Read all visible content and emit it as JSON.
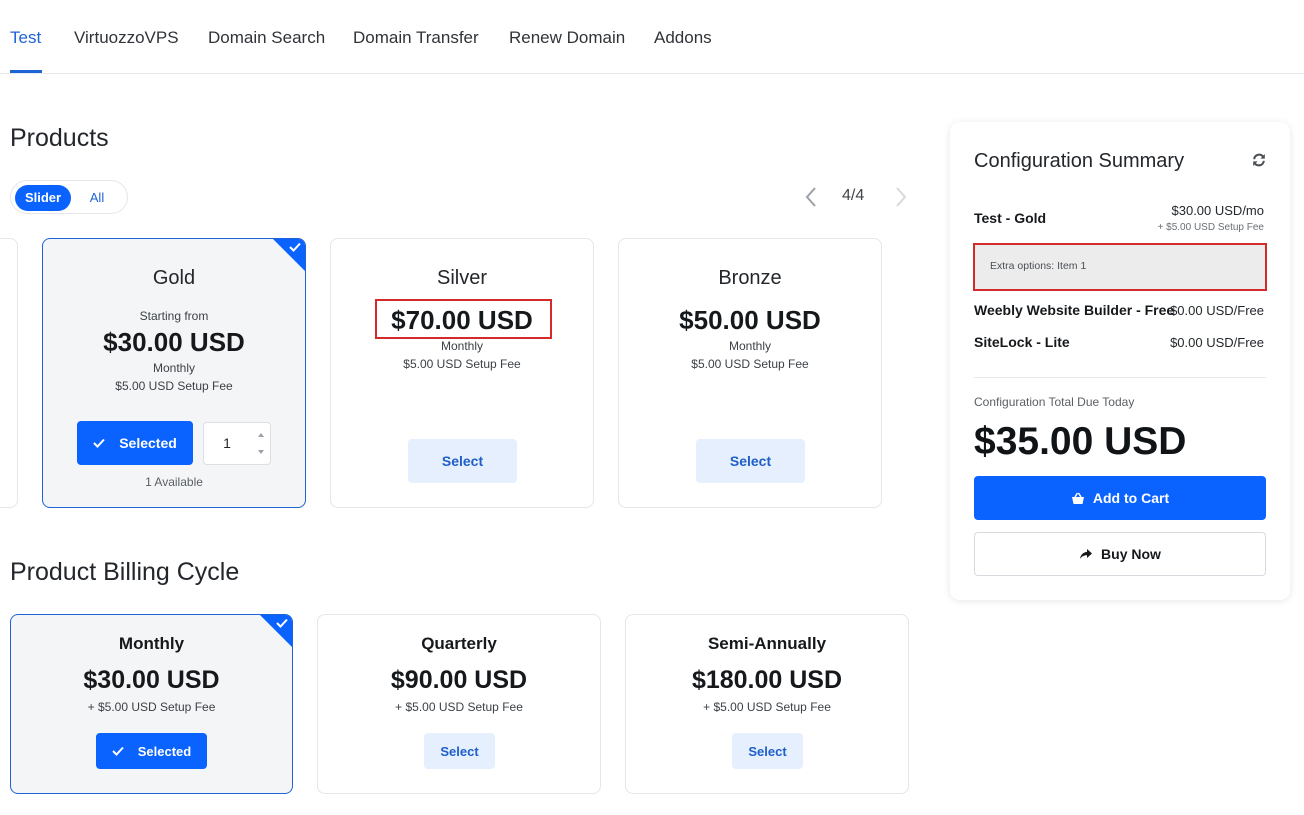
{
  "nav": {
    "tabs": [
      {
        "label": "Test",
        "active": true
      },
      {
        "label": "VirtuozzoVPS",
        "active": false
      },
      {
        "label": "Domain Search",
        "active": false
      },
      {
        "label": "Domain Transfer",
        "active": false
      },
      {
        "label": "Renew Domain",
        "active": false
      },
      {
        "label": "Addons",
        "active": false
      }
    ]
  },
  "products": {
    "title": "Products",
    "view_toggle": {
      "slider": "Slider",
      "all": "All",
      "selected": "Slider"
    },
    "pager": {
      "count": "4/4"
    },
    "cards": [
      {
        "name": "Gold",
        "starting_label": "Starting from",
        "price": "$30.00 USD",
        "cycle": "Monthly",
        "setup": "$5.00 USD Setup Fee",
        "button": "Selected",
        "quantity": "1",
        "available": "1 Available",
        "selected": true
      },
      {
        "name": "Silver",
        "price": "$70.00 USD",
        "cycle": "Monthly",
        "setup": "$5.00 USD Setup Fee",
        "button": "Select",
        "selected": false
      },
      {
        "name": "Bronze",
        "price": "$50.00 USD",
        "cycle": "Monthly",
        "setup": "$5.00 USD Setup Fee",
        "button": "Select",
        "selected": false
      }
    ]
  },
  "billing": {
    "title": "Product Billing Cycle",
    "cycles": [
      {
        "name": "Monthly",
        "price": "$30.00 USD",
        "setup": "+ $5.00 USD Setup Fee",
        "button": "Selected",
        "selected": true
      },
      {
        "name": "Quarterly",
        "price": "$90.00 USD",
        "setup": "+ $5.00 USD Setup Fee",
        "button": "Select",
        "selected": false
      },
      {
        "name": "Semi-Annually",
        "price": "$180.00 USD",
        "setup": "+ $5.00 USD Setup Fee",
        "button": "Select",
        "selected": false
      }
    ]
  },
  "summary": {
    "title": "Configuration Summary",
    "product_name": "Test - Gold",
    "product_price": "$30.00 USD/mo",
    "product_setup": "+ $5.00 USD Setup Fee",
    "extra_options": "Extra options: Item 1",
    "lines": [
      {
        "name": "Weebly Website Builder - Free",
        "price": "$0.00 USD/Free"
      },
      {
        "name": "SiteLock - Lite",
        "price": "$0.00 USD/Free"
      }
    ],
    "total_label": "Configuration Total Due Today",
    "total": "$35.00 USD",
    "add_to_cart": "Add to Cart",
    "buy_now": "Buy Now"
  },
  "colors": {
    "accent": "#0a62ff",
    "tab_active": "#1f63d6",
    "select_button_bg": "#e6effd",
    "highlight_box": "#d32a2a"
  }
}
